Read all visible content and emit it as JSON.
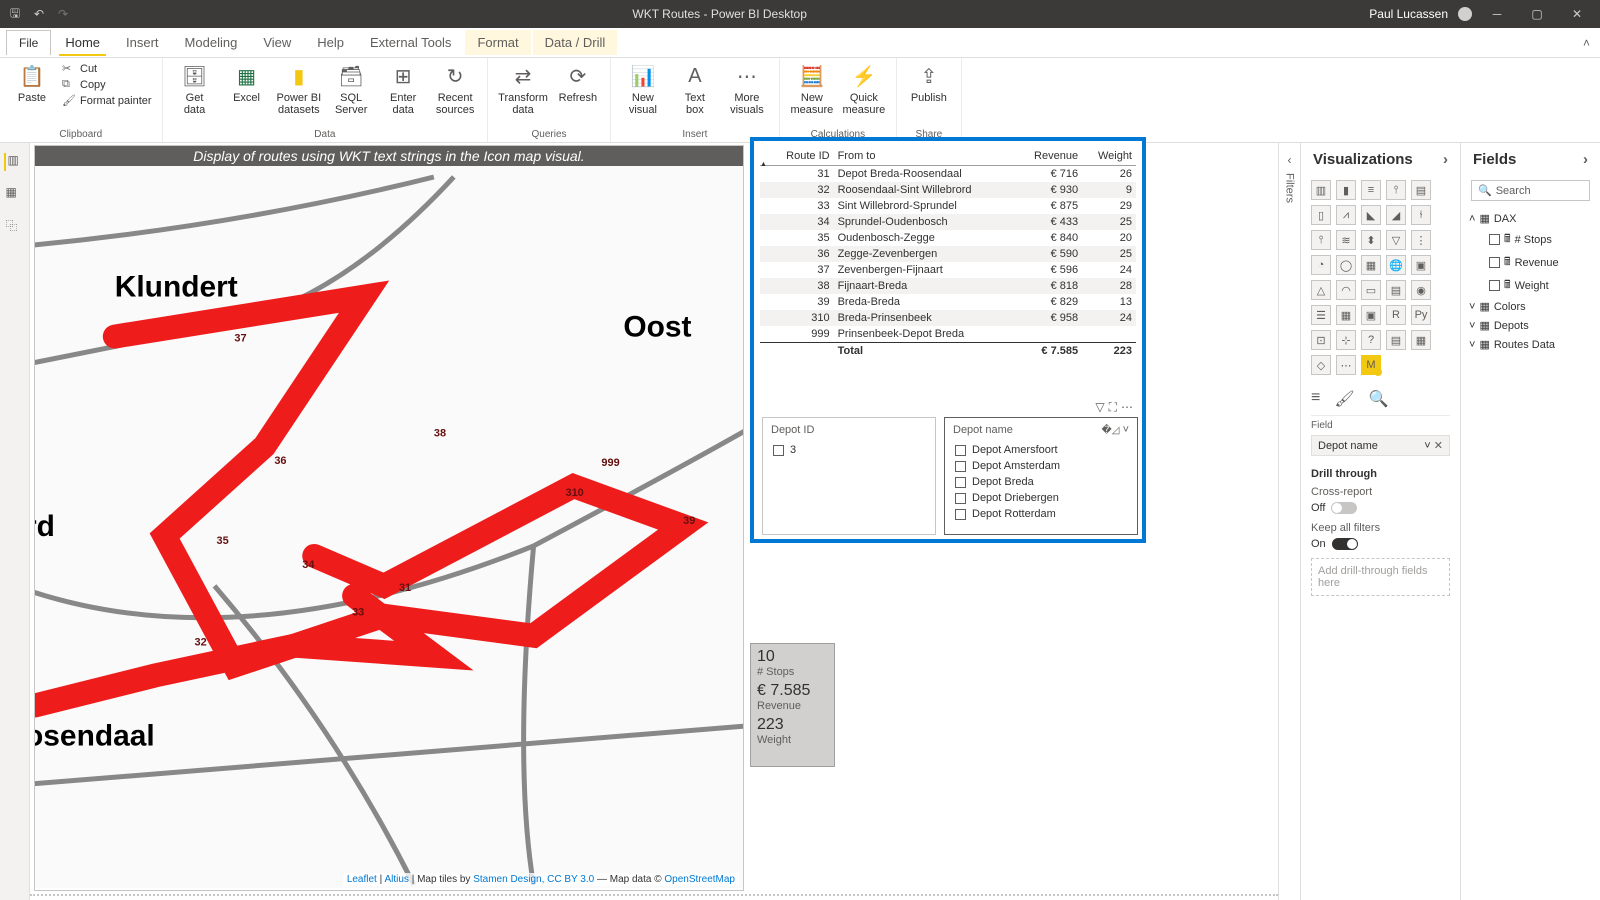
{
  "app": {
    "title": "WKT Routes - Power BI Desktop",
    "user": "Paul Lucassen"
  },
  "ribbon": {
    "file": "File",
    "tabs": [
      "Home",
      "Insert",
      "Modeling",
      "View",
      "Help",
      "External Tools",
      "Format",
      "Data / Drill"
    ],
    "active": "Home",
    "clipboard": {
      "paste": "Paste",
      "cut": "Cut",
      "copy": "Copy",
      "fmt": "Format painter",
      "label": "Clipboard"
    },
    "data": {
      "getdata": "Get\ndata",
      "excel": "Excel",
      "pbi": "Power BI\ndatasets",
      "sql": "SQL\nServer",
      "enter": "Enter\ndata",
      "recent": "Recent\nsources",
      "label": "Data"
    },
    "queries": {
      "transform": "Transform\ndata",
      "refresh": "Refresh",
      "label": "Queries"
    },
    "insert": {
      "newvis": "New\nvisual",
      "textbox": "Text\nbox",
      "more": "More\nvisuals",
      "label": "Insert"
    },
    "calc": {
      "newmeasure": "New\nmeasure",
      "quick": "Quick\nmeasure",
      "label": "Calculations"
    },
    "share": {
      "publish": "Publish",
      "label": "Share"
    }
  },
  "map": {
    "title": "Display of routes using WKT text strings in the Icon map visual.",
    "towns": {
      "klundert": "Klundert",
      "oost": "Oost",
      "rd": "rd",
      "osendaal": "osendaal"
    },
    "routelabels": [
      "37",
      "38",
      "36",
      "999",
      "310",
      "39",
      "35",
      "34",
      "31",
      "33",
      "32",
      "36"
    ],
    "attribution": {
      "leaflet": "Leaflet",
      "altius": "Altius",
      "tiles": " | Map tiles by ",
      "stamen": "Stamen Design, CC BY 3.0",
      "mapdata": " — Map data © ",
      "osm": "OpenStreetMap"
    }
  },
  "chart_data": {
    "type": "table",
    "columns": [
      "Route ID",
      "From to",
      "Revenue",
      "Weight"
    ],
    "rows": [
      {
        "id": "31",
        "ft": "Depot Breda-Roosendaal",
        "rev": "€ 716",
        "wt": "26"
      },
      {
        "id": "32",
        "ft": "Roosendaal-Sint Willebrord",
        "rev": "€ 930",
        "wt": "9"
      },
      {
        "id": "33",
        "ft": "Sint Willebrord-Sprundel",
        "rev": "€ 875",
        "wt": "29"
      },
      {
        "id": "34",
        "ft": "Sprundel-Oudenbosch",
        "rev": "€ 433",
        "wt": "25"
      },
      {
        "id": "35",
        "ft": "Oudenbosch-Zegge",
        "rev": "€ 840",
        "wt": "20"
      },
      {
        "id": "36",
        "ft": "Zegge-Zevenbergen",
        "rev": "€ 590",
        "wt": "25"
      },
      {
        "id": "37",
        "ft": "Zevenbergen-Fijnaart",
        "rev": "€ 596",
        "wt": "24"
      },
      {
        "id": "38",
        "ft": "Fijnaart-Breda",
        "rev": "€ 818",
        "wt": "28"
      },
      {
        "id": "39",
        "ft": "Breda-Breda",
        "rev": "€ 829",
        "wt": "13"
      },
      {
        "id": "310",
        "ft": "Breda-Prinsenbeek",
        "rev": "€ 958",
        "wt": "24"
      },
      {
        "id": "999",
        "ft": "Prinsenbeek-Depot Breda",
        "rev": "",
        "wt": ""
      }
    ],
    "total": {
      "label": "Total",
      "rev": "€ 7.585",
      "wt": "223"
    }
  },
  "slicer1": {
    "title": "Depot ID",
    "items": [
      "3"
    ]
  },
  "slicer2": {
    "title": "Depot name",
    "items": [
      "Depot Amersfoort",
      "Depot Amsterdam",
      "Depot Breda",
      "Depot Driebergen",
      "Depot Rotterdam"
    ]
  },
  "cards": {
    "v1": "10",
    "l1": "# Stops",
    "v2": "€ 7.585",
    "l2": "Revenue",
    "v3": "223",
    "l3": "Weight"
  },
  "vizpane": {
    "title": "Visualizations",
    "field_label": "Field",
    "field_chip": "Depot name",
    "drill": "Drill through",
    "cross": "Cross-report",
    "cross_state": "Off",
    "keep": "Keep all filters",
    "keep_state": "On",
    "dropwell": "Add drill-through fields here"
  },
  "fieldspane": {
    "title": "Fields",
    "search": "Search",
    "tables": [
      {
        "name": "DAX",
        "fields": [
          "# Stops",
          "Revenue",
          "Weight"
        ]
      },
      {
        "name": "Colors",
        "fields": []
      },
      {
        "name": "Depots",
        "fields": []
      },
      {
        "name": "Routes Data",
        "fields": []
      }
    ]
  },
  "filters": {
    "label": "Filters"
  }
}
